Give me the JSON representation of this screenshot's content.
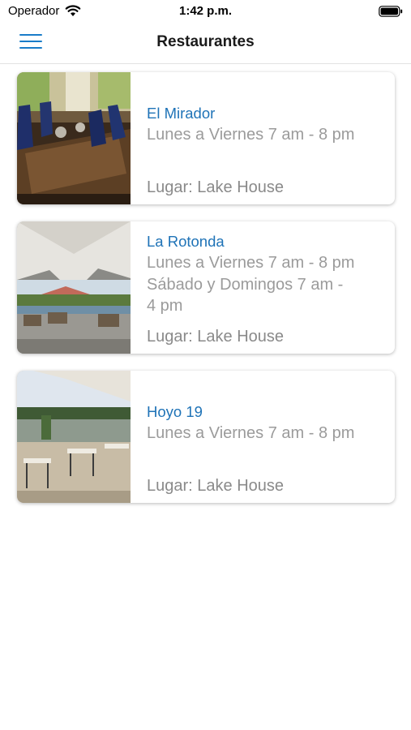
{
  "status_bar": {
    "carrier": "Operador",
    "time": "1:42 p.m.",
    "wifi_icon": "wifi-icon",
    "battery_icon": "battery-full-icon"
  },
  "nav": {
    "title": "Restaurantes",
    "menu_icon": "hamburger-menu-icon",
    "accent_color": "#1a7cc8"
  },
  "restaurants": [
    {
      "name": "El Mirador",
      "hours": [
        "Lunes a Viernes 7 am - 8 pm"
      ],
      "place": "Lugar: Lake House"
    },
    {
      "name": "La Rotonda",
      "hours": [
        "Lunes a Viernes 7 am - 8 pm",
        "Sábado y Domingos 7 am -",
        "4 pm"
      ],
      "place": "Lugar: Lake House"
    },
    {
      "name": "Hoyo 19",
      "hours": [
        "Lunes a Viernes 7 am - 8 pm"
      ],
      "place": "Lugar: Lake House"
    }
  ]
}
